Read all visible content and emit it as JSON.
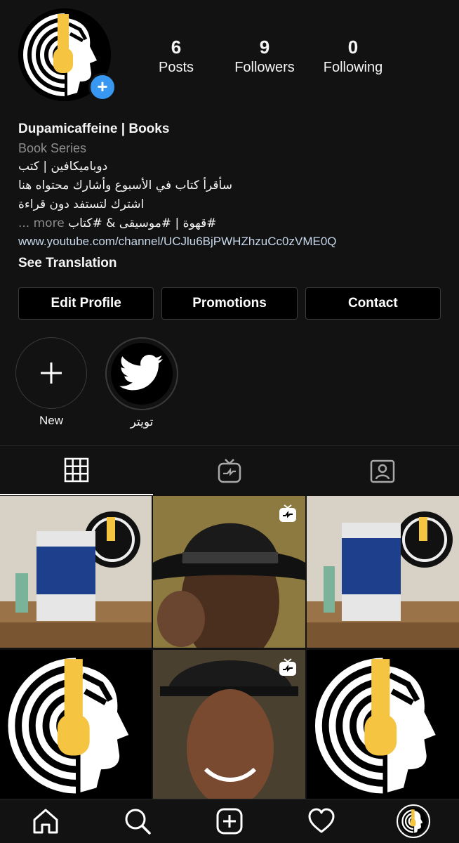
{
  "profile": {
    "name": "Dupamicaffeine | Books",
    "category": "Book Series",
    "bio_lines": [
      "دوباميكافين | كتب",
      "سأقرأ كتاب في الأسبوع وأشارك محتواه هنا",
      "اشترك لتستفد دون قراءة"
    ],
    "more_line": "#قهوة | #موسيقى & #كتاب",
    "more_label": "... more",
    "link": "www.youtube.com/channel/UCJlu6BjPWHZhzuCc0zVME0Q",
    "see_translation": "See Translation",
    "avatar_colors": {
      "yellow": "#f5c542",
      "white": "#ffffff",
      "black": "#000000"
    }
  },
  "stats": [
    {
      "value": "6",
      "label": "Posts"
    },
    {
      "value": "9",
      "label": "Followers"
    },
    {
      "value": "0",
      "label": "Following"
    }
  ],
  "buttons": {
    "edit": "Edit Profile",
    "promotions": "Promotions",
    "contact": "Contact"
  },
  "highlights": [
    {
      "label": "New",
      "icon": "plus-icon"
    },
    {
      "label": "تويتر",
      "icon": "twitter-bird-icon"
    }
  ],
  "tabs": [
    {
      "icon": "grid-icon",
      "active": true
    },
    {
      "icon": "igtv-icon",
      "active": false
    },
    {
      "icon": "tagged-icon",
      "active": false
    }
  ],
  "posts": [
    {
      "type": "book-photo",
      "igtv": false
    },
    {
      "type": "person-photo",
      "igtv": true
    },
    {
      "type": "book-photo",
      "igtv": false
    },
    {
      "type": "logo",
      "igtv": false
    },
    {
      "type": "person-photo",
      "igtv": true
    },
    {
      "type": "logo",
      "igtv": false
    }
  ],
  "bottom_nav": [
    "home-icon",
    "search-icon",
    "new-post-icon",
    "activity-heart-icon",
    "profile-avatar-icon"
  ],
  "accent": "#3897f0"
}
